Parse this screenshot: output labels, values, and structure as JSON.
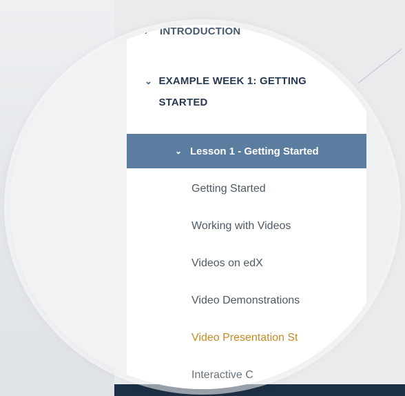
{
  "sidebar": {
    "sections": [
      {
        "label": "INTRODUCTION",
        "expanded": false
      },
      {
        "label": "EXAMPLE WEEK 1: GETTING STARTED",
        "expanded": true
      }
    ],
    "lesson": {
      "label": "Lesson 1 - Getting Started",
      "expanded": true
    },
    "units": [
      {
        "label": "Getting Started",
        "active": false
      },
      {
        "label": "Working with Videos",
        "active": false
      },
      {
        "label": "Videos on edX",
        "active": false
      },
      {
        "label": "Video Demonstrations",
        "active": false
      },
      {
        "label": "Video Presentation St",
        "active": true
      },
      {
        "label": "Interactive C",
        "active": false
      }
    ]
  },
  "colors": {
    "lesson_bg": "#5b7d9f",
    "section_text": "#273a52",
    "active_unit": "#c48b1f",
    "unit_text": "#4f5963"
  },
  "icons": {
    "collapsed": "chevron-right-icon",
    "expanded": "chevron-down-icon"
  }
}
